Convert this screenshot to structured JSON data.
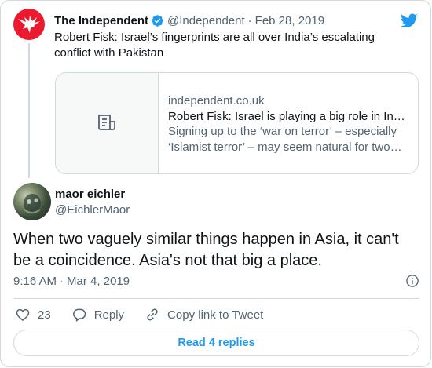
{
  "parent_tweet": {
    "author_name": "The Independent",
    "author_handle": "@Independent",
    "separator": "·",
    "date": "Feb 28, 2019",
    "text": "Robert Fisk: Israel’s fingerprints are all over India’s escalating conflict with Pakistan",
    "link_card": {
      "domain": "independent.co.uk",
      "title": "Robert Fisk: Israel is playing a big role in India’s escalating conflict with Pakistan",
      "description": "Signing up to the ‘war on terror’ – especially ‘Islamist terror’ – may seem natural for two nationalist governments",
      "thumbnail_icon": "article-icon"
    },
    "logo_icon": "bird-icon",
    "verified_icon": "verified-badge-icon"
  },
  "reply_tweet": {
    "author_name": "maor eichler",
    "author_handle": "@EichlerMaor",
    "text": "When two vaguely similar things happen in Asia, it can't be a coincidence. Asia's not that big a place.",
    "time": "9:16 AM",
    "separator": "·",
    "date": "Mar 4, 2019",
    "info_icon": "info-icon"
  },
  "actions": {
    "like_count": "23",
    "reply_label": "Reply",
    "copy_link_label": "Copy link to Tweet"
  },
  "read_replies_label": "Read 4 replies",
  "colors": {
    "accent": "#1d9bf0",
    "brand_red": "#ec1a2e",
    "text_primary": "#0f1419",
    "text_secondary": "#536471",
    "border": "#cfd9de"
  }
}
